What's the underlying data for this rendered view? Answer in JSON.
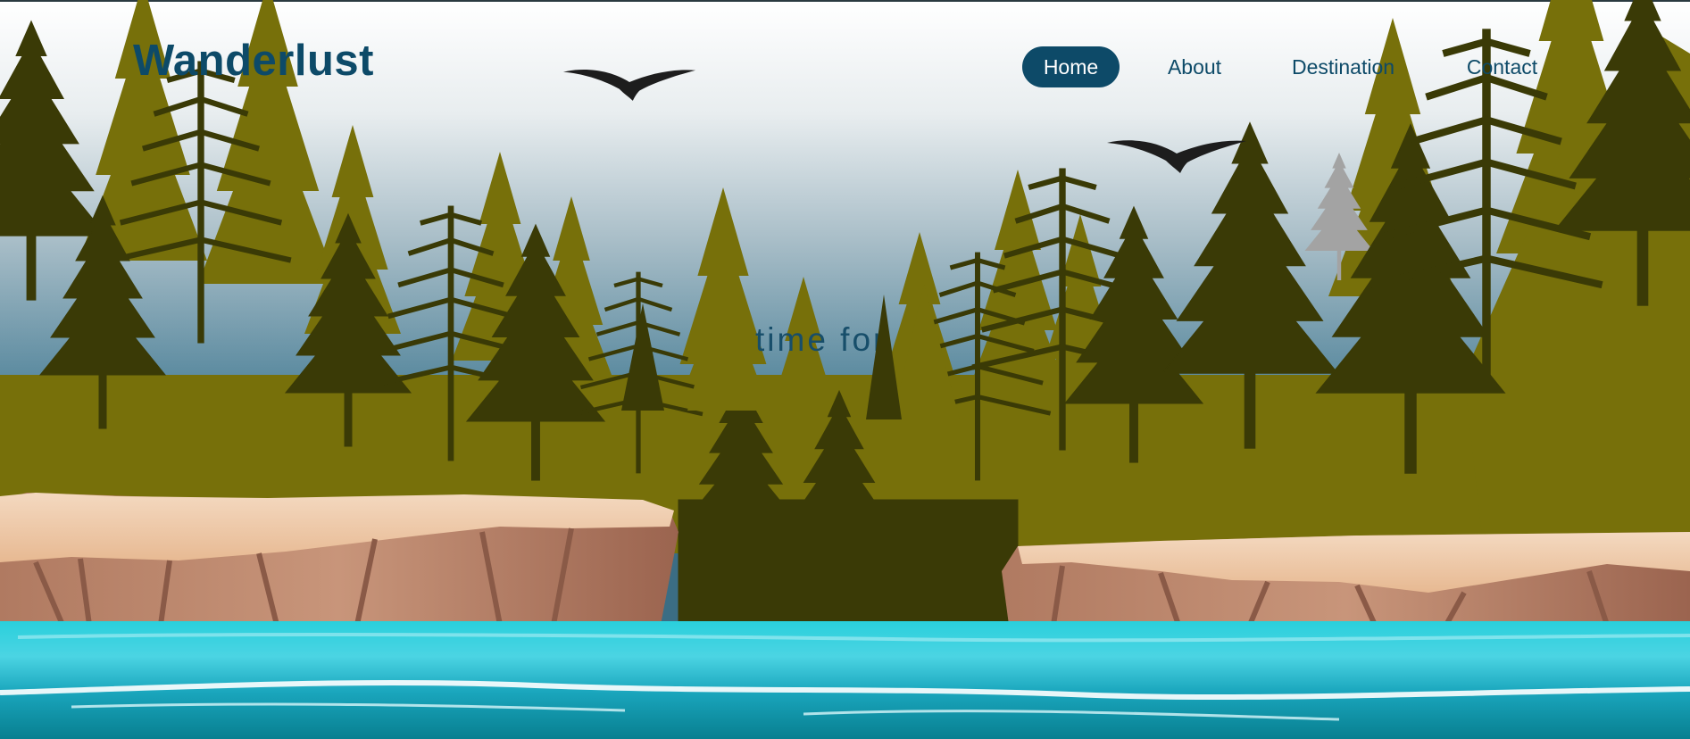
{
  "brand": {
    "name": "Wanderlust"
  },
  "nav": {
    "items": [
      {
        "label": "Home",
        "active": true
      },
      {
        "label": "About",
        "active": false
      },
      {
        "label": "Destination",
        "active": false
      },
      {
        "label": "Contact",
        "active": false
      }
    ]
  },
  "hero": {
    "partial_text": "time for"
  },
  "colors": {
    "brand_navy": "#0d4a68",
    "sky_top": "#ffffff",
    "sky_bottom": "#4a7d92",
    "olive_trees": "#77700a",
    "dark_trees": "#3a3a06",
    "cliff": "#c08a6e",
    "water": "#1aa6bd"
  },
  "icons": [
    "bird-icon",
    "bird-icon",
    "pine-tree-icon",
    "fir-tree-icon",
    "cliff-shape",
    "water-wave"
  ]
}
